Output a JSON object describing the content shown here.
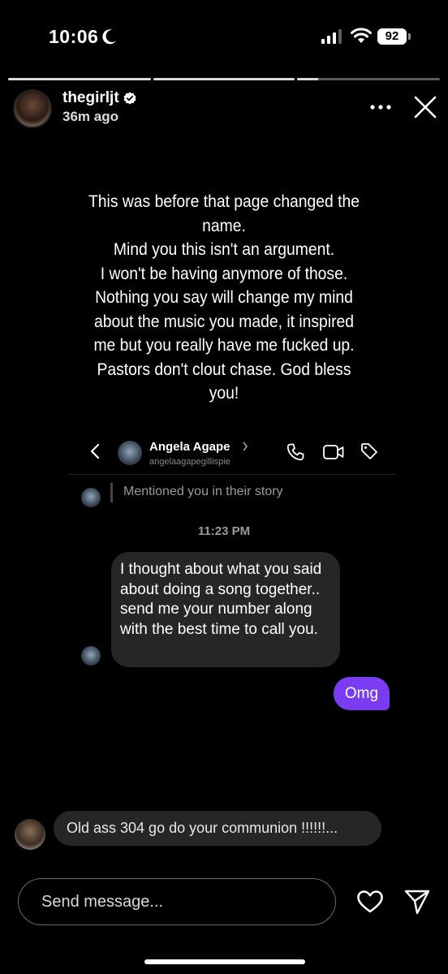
{
  "status_bar": {
    "time": "10:06",
    "battery": "92"
  },
  "story": {
    "progress": [
      1,
      1,
      0.15
    ],
    "username": "thegirljt",
    "time_ago": "36m ago",
    "caption": "This was before that page changed the name.\nMind you this isn't an argument.\nI won't be having anymore of those.\nNothing you say will change my mind about the music you made, it inspired me but you really have me fucked up. Pastors don't clout chase. God bless you!"
  },
  "dm": {
    "name": "Angela Agape",
    "handle": "angelaagapegillispie",
    "mention": "Mentioned you in their story",
    "timestamp": "11:23 PM",
    "incoming_message": "I thought about what you said about doing a song together.. send me your number along with the best time to call you.",
    "outgoing_message": "Omg"
  },
  "comment": {
    "text": "Old ass 304 go do your communion !!!!!!..."
  },
  "composer": {
    "placeholder": "Send message..."
  },
  "colors": {
    "accent": "#7a3cf0",
    "bubble": "#262626",
    "background": "#000000"
  },
  "icons": [
    "moon-icon",
    "signal-icon",
    "wifi-icon",
    "verified-icon",
    "more-icon",
    "close-icon",
    "back-icon",
    "chevron-right-icon",
    "phone-icon",
    "video-icon",
    "tag-icon",
    "heart-icon",
    "send-icon"
  ]
}
